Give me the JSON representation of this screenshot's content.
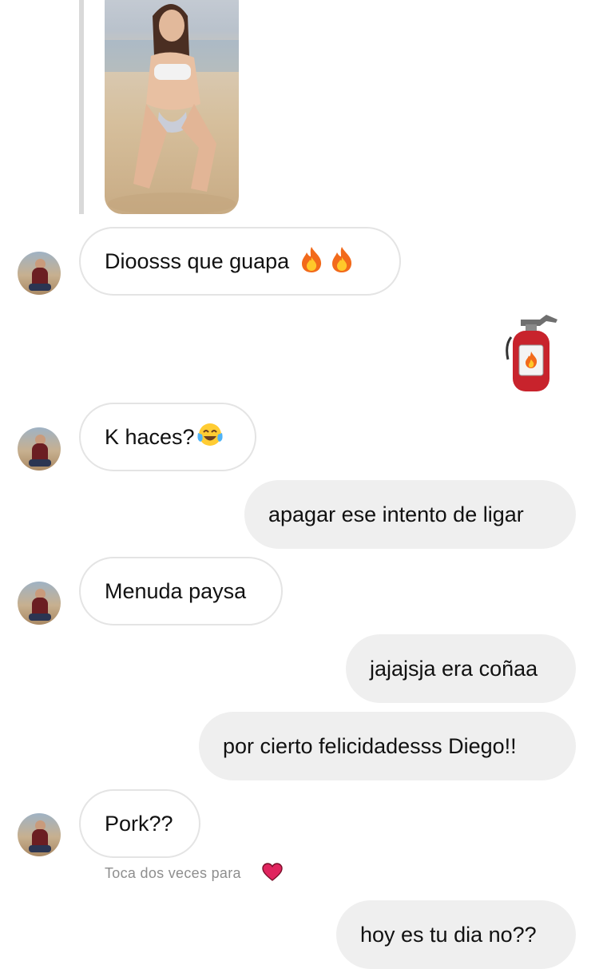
{
  "messages": [
    {
      "id": "m1",
      "text": "Dioosss que guapa"
    },
    {
      "id": "m2",
      "text": "K haces?"
    },
    {
      "id": "m3",
      "text": "apagar ese intento de ligar"
    },
    {
      "id": "m4",
      "text": "Menuda paysa"
    },
    {
      "id": "m5",
      "text": "jajajsja era coñaa"
    },
    {
      "id": "m6",
      "text": "por cierto felicidadesss Diego!!"
    },
    {
      "id": "m7",
      "text": "Pork??"
    },
    {
      "id": "m8",
      "text": "hoy es tu dia no??"
    }
  ],
  "reaction_hint": "Toca dos veces para",
  "icons": {
    "fire": "fire-emoji",
    "laugh": "tears-of-joy-emoji",
    "extinguisher": "fire-extinguisher-emoji",
    "heart": "red-heart-icon"
  },
  "colors": {
    "incoming_bubble_border": "#e4e4e4",
    "outgoing_bubble": "#efefef",
    "hint_text": "#8e8e8e",
    "heart": "#e0245e"
  }
}
